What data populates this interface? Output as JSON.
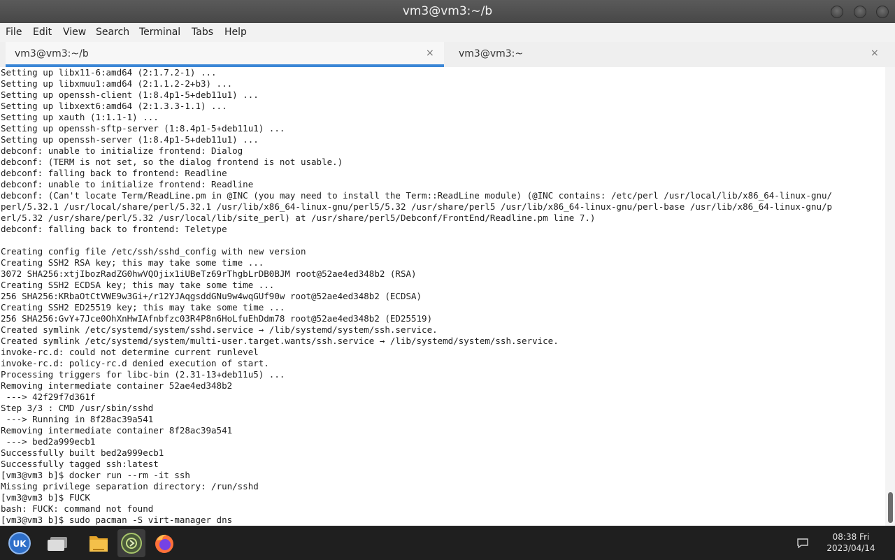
{
  "window": {
    "title": "vm3@vm3:~/b"
  },
  "menu": [
    "File",
    "Edit",
    "View",
    "Search",
    "Terminal",
    "Tabs",
    "Help"
  ],
  "tabs": [
    {
      "label": "vm3@vm3:~/b",
      "close": "×",
      "active": true
    },
    {
      "label": "vm3@vm3:~",
      "close": "×",
      "active": false
    }
  ],
  "terminal": {
    "lines": [
      "Setting up libx11-6:amd64 (2:1.7.2-1) ...",
      "Setting up libxmuu1:amd64 (2:1.1.2-2+b3) ...",
      "Setting up openssh-client (1:8.4p1-5+deb11u1) ...",
      "Setting up libxext6:amd64 (2:1.3.3-1.1) ...",
      "Setting up xauth (1:1.1-1) ...",
      "Setting up openssh-sftp-server (1:8.4p1-5+deb11u1) ...",
      "Setting up openssh-server (1:8.4p1-5+deb11u1) ...",
      "debconf: unable to initialize frontend: Dialog",
      "debconf: (TERM is not set, so the dialog frontend is not usable.)",
      "debconf: falling back to frontend: Readline",
      "debconf: unable to initialize frontend: Readline",
      "debconf: (Can't locate Term/ReadLine.pm in @INC (you may need to install the Term::ReadLine module) (@INC contains: /etc/perl /usr/local/lib/x86_64-linux-gnu/",
      "perl/5.32.1 /usr/local/share/perl/5.32.1 /usr/lib/x86_64-linux-gnu/perl5/5.32 /usr/share/perl5 /usr/lib/x86_64-linux-gnu/perl-base /usr/lib/x86_64-linux-gnu/p",
      "erl/5.32 /usr/share/perl/5.32 /usr/local/lib/site_perl) at /usr/share/perl5/Debconf/FrontEnd/Readline.pm line 7.)",
      "debconf: falling back to frontend: Teletype",
      "",
      "Creating config file /etc/ssh/sshd_config with new version",
      "Creating SSH2 RSA key; this may take some time ...",
      "3072 SHA256:xtjIbozRadZG0hwVQOjix1iUBeTz69rThgbLrDB0BJM root@52ae4ed348b2 (RSA)",
      "Creating SSH2 ECDSA key; this may take some time ...",
      "256 SHA256:KRbaOtCtVWE9w3Gi+/r12YJAqgsddGNu9w4wqGUf90w root@52ae4ed348b2 (ECDSA)",
      "Creating SSH2 ED25519 key; this may take some time ...",
      "256 SHA256:GvY+7Jce0OhXnHwIAfnbfzc03R4P8n6HoLfuEhDdm78 root@52ae4ed348b2 (ED25519)",
      "Created symlink /etc/systemd/system/sshd.service → /lib/systemd/system/ssh.service.",
      "Created symlink /etc/systemd/system/multi-user.target.wants/ssh.service → /lib/systemd/system/ssh.service.",
      "invoke-rc.d: could not determine current runlevel",
      "invoke-rc.d: policy-rc.d denied execution of start.",
      "Processing triggers for libc-bin (2.31-13+deb11u5) ...",
      "Removing intermediate container 52ae4ed348b2",
      " ---> 42f29f7d361f",
      "Step 3/3 : CMD /usr/sbin/sshd",
      " ---> Running in 8f28ac39a541",
      "Removing intermediate container 8f28ac39a541",
      " ---> bed2a999ecb1",
      "Successfully built bed2a999ecb1",
      "Successfully tagged ssh:latest",
      "[vm3@vm3 b]$ docker run --rm -it ssh",
      "Missing privilege separation directory: /run/sshd",
      "[vm3@vm3 b]$ FUCK",
      "bash: FUCK: command not found",
      "[vm3@vm3 b]$ sudo pacman -S virt-manager dns"
    ]
  },
  "taskbar": {
    "items": [
      "start-menu-icon",
      "desktop-icon",
      "file-manager-icon",
      "terminal-icon",
      "firefox-icon"
    ],
    "clock_time": "08:38 Fri",
    "clock_date": "2023/04/14"
  },
  "colors": {
    "accent": "#3a86d6",
    "titlebar": "#4d4d4d",
    "taskbar": "#1f1f1f"
  }
}
